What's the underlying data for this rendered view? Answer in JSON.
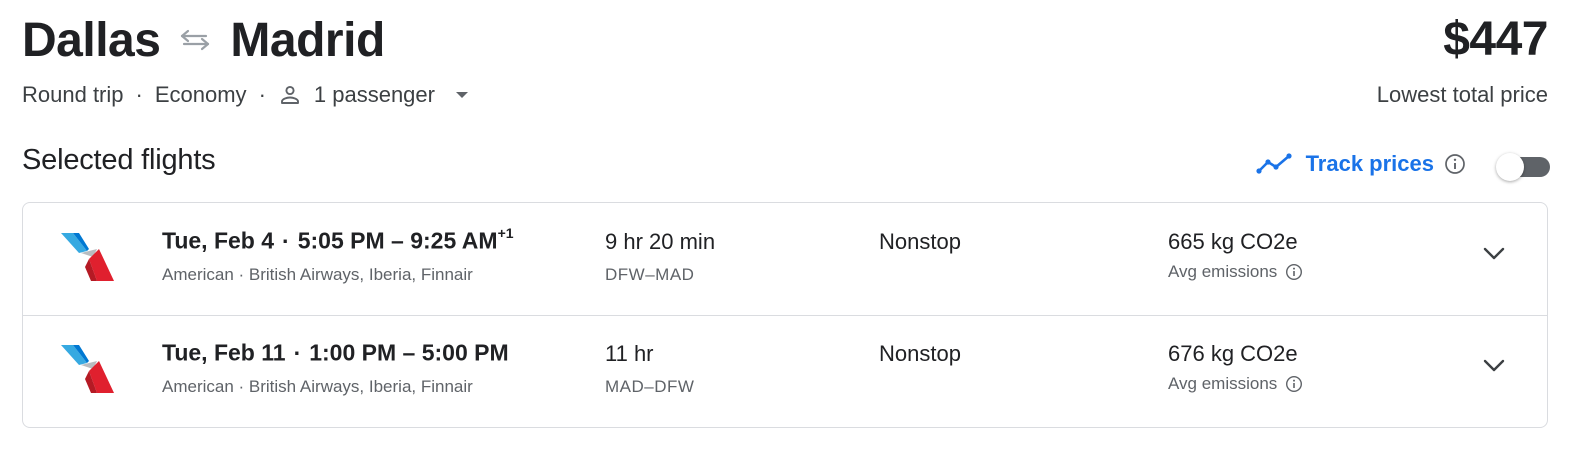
{
  "trip": {
    "origin": "Dallas",
    "destination": "Madrid",
    "type": "Round trip",
    "cabin": "Economy",
    "passengers": "1 passenger"
  },
  "price": {
    "amount": "$447",
    "label": "Lowest total price"
  },
  "section_title": "Selected flights",
  "track_prices": {
    "label": "Track prices",
    "enabled": false
  },
  "flights": [
    {
      "date": "Tue, Feb 4",
      "time_range": "5:05 PM – 9:25 AM",
      "day_offset": "+1",
      "carriers": "American · British Airways, Iberia, Finnair",
      "duration": "9 hr 20 min",
      "airports": "DFW–MAD",
      "stops": "Nonstop",
      "emissions": "665 kg CO2e",
      "emissions_label": "Avg emissions"
    },
    {
      "date": "Tue, Feb 11",
      "time_range": "1:00 PM – 5:00 PM",
      "day_offset": "",
      "carriers": "American · British Airways, Iberia, Finnair",
      "duration": "11 hr",
      "airports": "MAD–DFW",
      "stops": "Nonstop",
      "emissions": "676 kg CO2e",
      "emissions_label": "Avg emissions"
    }
  ],
  "colors": {
    "accent": "#1a73e8",
    "text_primary": "#202124",
    "text_secondary": "#5f6368",
    "border": "#dadce0"
  },
  "icons": {
    "swap": "swap-arrows-icon",
    "person": "person-icon",
    "dropdown": "dropdown-triangle-icon",
    "track": "trend-line-icon",
    "info": "info-icon",
    "expand": "chevron-down-icon",
    "airline": "american-airlines-logo"
  }
}
